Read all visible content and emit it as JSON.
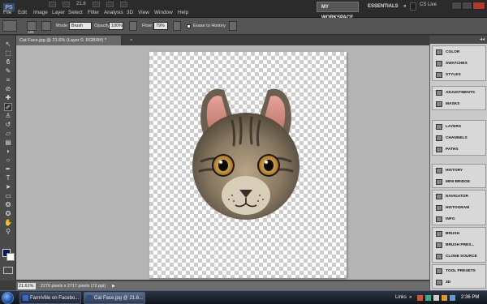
{
  "app": {
    "logo": "PS"
  },
  "menubar": {
    "items": [
      "File",
      "Edit",
      "Image",
      "Layer",
      "Select",
      "Filter",
      "Analysis",
      "3D",
      "View",
      "Window",
      "Help"
    ],
    "zoom": "21.6",
    "workspace_active": "MY WORKSPACE",
    "workspace_other": "ESSENTIALS",
    "more": "»",
    "cs_live": "CS Live"
  },
  "options": {
    "brush_size": "125",
    "mode_label": "Mode:",
    "mode_value": "Brush",
    "opacity_label": "Opacity:",
    "opacity_value": "100%",
    "flow_label": "Flow:",
    "flow_value": "79%",
    "erase_history_label": "Erase to History"
  },
  "tools": [
    {
      "name": "move-tool",
      "glyph": "↖"
    },
    {
      "name": "marquee-tool",
      "glyph": "⬚"
    },
    {
      "name": "lasso-tool",
      "glyph": "ϐ"
    },
    {
      "name": "quick-selection-tool",
      "glyph": "✎"
    },
    {
      "name": "crop-tool",
      "glyph": "⌗"
    },
    {
      "name": "eyedropper-tool",
      "glyph": "⊘"
    },
    {
      "name": "healing-brush-tool",
      "glyph": "✚"
    },
    {
      "name": "brush-tool",
      "glyph": "✐"
    },
    {
      "name": "clone-stamp-tool",
      "glyph": "♙"
    },
    {
      "name": "history-brush-tool",
      "glyph": "↺"
    },
    {
      "name": "eraser-tool",
      "glyph": "▱"
    },
    {
      "name": "gradient-tool",
      "glyph": "▤"
    },
    {
      "name": "blur-tool",
      "glyph": "◗"
    },
    {
      "name": "dodge-tool",
      "glyph": "○"
    },
    {
      "name": "pen-tool",
      "glyph": "✒"
    },
    {
      "name": "type-tool",
      "glyph": "T"
    },
    {
      "name": "path-selection-tool",
      "glyph": "➤"
    },
    {
      "name": "shape-tool",
      "glyph": "▭"
    },
    {
      "name": "3d-rotate-tool",
      "glyph": "❂"
    },
    {
      "name": "3d-orbit-tool",
      "glyph": "✪"
    },
    {
      "name": "hand-tool",
      "glyph": "✋"
    },
    {
      "name": "zoom-tool",
      "glyph": "⚲"
    }
  ],
  "tool_colors": {
    "foreground": "#0a1654",
    "background": "#ffffff"
  },
  "document": {
    "tab_title": "Cat Face.jpg @ 21.6% (Layer 0, RGB/8#) *",
    "close": "×",
    "zoom_field": "21.61%",
    "info": "2270 pixels x 2717 pixels (72 ppi)",
    "arrow": "▶"
  },
  "panels": {
    "collapse": "◂◂",
    "groups": [
      [
        "COLOR",
        "SWATCHES",
        "STYLES"
      ],
      [
        "ADJUSTMENTS",
        "MASKS"
      ],
      [
        "LAYERS",
        "CHANNELS",
        "PATHS"
      ],
      [
        "HISTORY",
        "MINI BRIDGE"
      ],
      [
        "NAVIGATOR",
        "HISTOGRAM",
        "INFO"
      ],
      [
        "BRUSH",
        "BRUSH PRES...",
        "CLONE SOURCE"
      ],
      [
        "TOOL PRESETS",
        "3D"
      ]
    ]
  },
  "taskbar": {
    "tasks": [
      "FarmVille on Facebo...",
      "Cat Face.jpg @ 21.6..."
    ],
    "links": "Links",
    "tray_arrow": "»",
    "time": "2:36 PM"
  }
}
